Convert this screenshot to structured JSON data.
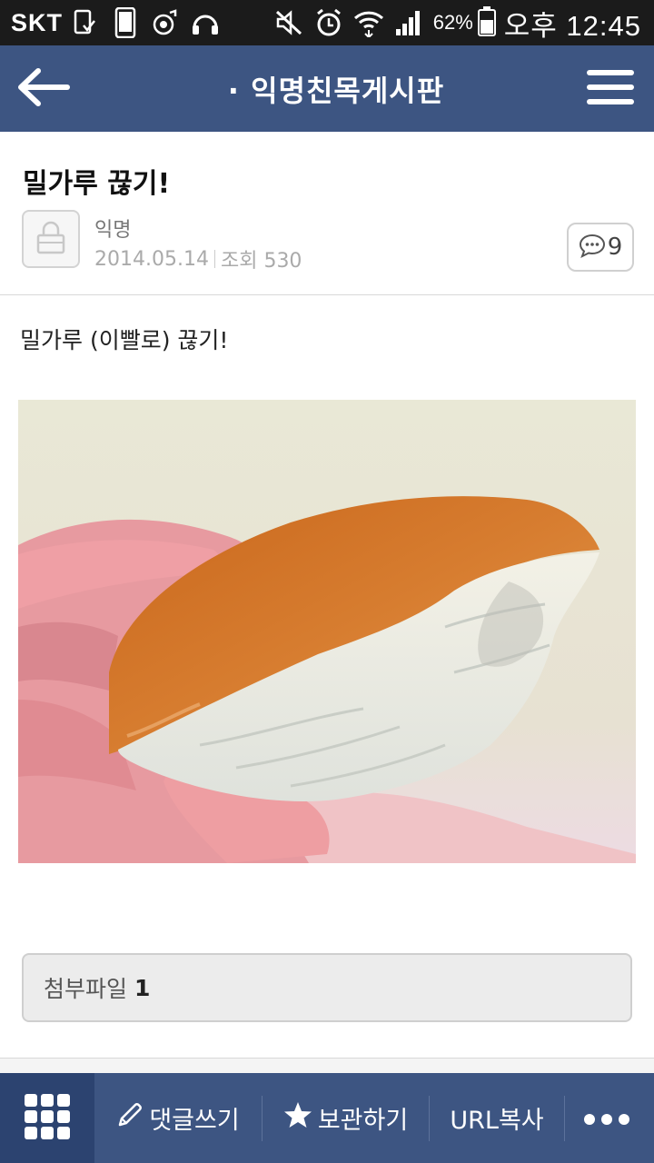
{
  "status_bar": {
    "carrier": "SKT",
    "battery_percent": "62%",
    "time": "오후 12:45",
    "icons": [
      "sim-card-icon",
      "phone-icon",
      "music-icon",
      "headset-icon",
      "mute-icon",
      "alarm-icon",
      "wifi-icon",
      "signal-icon",
      "battery-icon"
    ]
  },
  "header": {
    "title": "· 익명친목게시판",
    "back_icon": "back-arrow-icon",
    "menu_icon": "hamburger-menu-icon",
    "bg_color": "#3d5582"
  },
  "post": {
    "title": "밀가루 끊기!",
    "author": "익명",
    "date": "2014.05.14",
    "views_label": "조회 530",
    "comment_count": "9",
    "body": "밀가루 (이빨로) 끊기!",
    "photo": "bitten-bread-bun-in-hand-photo"
  },
  "attachment": {
    "label": "첨부파일",
    "count": "1"
  },
  "bottom_bar": {
    "write_comment": "댓글쓰기",
    "keep": "보관하기",
    "copy_url": "URL복사",
    "icons": [
      "grid-apps-icon",
      "pencil-icon",
      "star-icon",
      "more-dots-icon"
    ]
  }
}
